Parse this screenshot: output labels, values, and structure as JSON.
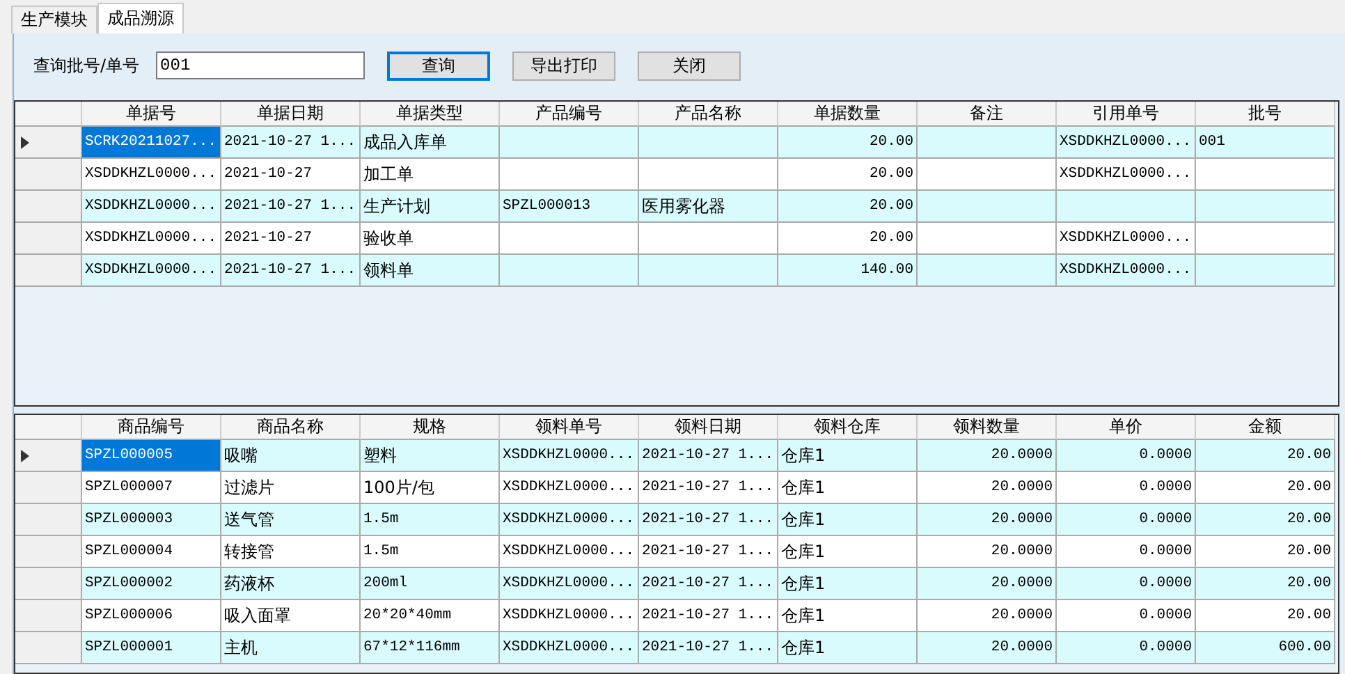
{
  "tabs": [
    {
      "label": "生产模块",
      "selected": false
    },
    {
      "label": "成品溯源",
      "selected": true
    }
  ],
  "query": {
    "label": "查询批号/单号",
    "value": "001"
  },
  "buttons": [
    {
      "label": "查询",
      "default": true
    },
    {
      "label": "导出打印",
      "default": false
    },
    {
      "label": "关闭",
      "default": false
    }
  ],
  "top_grid": {
    "columns": [
      {
        "title": "单据号",
        "kind": "text"
      },
      {
        "title": "单据日期",
        "kind": "text"
      },
      {
        "title": "单据类型",
        "kind": "text"
      },
      {
        "title": "产品编号",
        "kind": "text"
      },
      {
        "title": "产品名称",
        "kind": "text"
      },
      {
        "title": "单据数量",
        "kind": "number"
      },
      {
        "title": "备注",
        "kind": "text"
      },
      {
        "title": "引用单号",
        "kind": "text"
      },
      {
        "title": "批号",
        "kind": "text"
      }
    ],
    "rows": [
      {
        "selected": true,
        "cells": [
          "SCRK20211027...",
          "2021-10-27 1...",
          "成品入库单",
          "",
          "",
          "20.00",
          "",
          "XSDDKHZL0000...",
          "001"
        ]
      },
      {
        "selected": false,
        "cells": [
          "XSDDKHZL0000...",
          "2021-10-27",
          "加工单",
          "",
          "",
          "20.00",
          "",
          "XSDDKHZL0000...",
          ""
        ]
      },
      {
        "selected": false,
        "cells": [
          "XSDDKHZL0000...",
          "2021-10-27 1...",
          "生产计划",
          "SPZL000013",
          "医用雾化器",
          "20.00",
          "",
          "",
          ""
        ]
      },
      {
        "selected": false,
        "cells": [
          "XSDDKHZL0000...",
          "2021-10-27",
          "验收单",
          "",
          "",
          "20.00",
          "",
          "XSDDKHZL0000...",
          ""
        ]
      },
      {
        "selected": false,
        "cells": [
          "XSDDKHZL0000...",
          "2021-10-27 1...",
          "领料单",
          "",
          "",
          "140.00",
          "",
          "XSDDKHZL0000...",
          ""
        ]
      }
    ]
  },
  "bottom_grid": {
    "columns": [
      {
        "title": "商品编号",
        "kind": "text"
      },
      {
        "title": "商品名称",
        "kind": "text"
      },
      {
        "title": "规格",
        "kind": "text"
      },
      {
        "title": "领料单号",
        "kind": "text"
      },
      {
        "title": "领料日期",
        "kind": "text"
      },
      {
        "title": "领料仓库",
        "kind": "text"
      },
      {
        "title": "领料数量",
        "kind": "number"
      },
      {
        "title": "单价",
        "kind": "number"
      },
      {
        "title": "金额",
        "kind": "number"
      }
    ],
    "rows": [
      {
        "selected": true,
        "cells": [
          "SPZL000005",
          "吸嘴",
          "塑料",
          "XSDDKHZL0000...",
          "2021-10-27 1...",
          "仓库1",
          "20.0000",
          "0.0000",
          "20.00"
        ]
      },
      {
        "selected": false,
        "cells": [
          "SPZL000007",
          "过滤片",
          "100片/包",
          "XSDDKHZL0000...",
          "2021-10-27 1...",
          "仓库1",
          "20.0000",
          "0.0000",
          "20.00"
        ]
      },
      {
        "selected": false,
        "cells": [
          "SPZL000003",
          "送气管",
          "1.5m",
          "XSDDKHZL0000...",
          "2021-10-27 1...",
          "仓库1",
          "20.0000",
          "0.0000",
          "20.00"
        ]
      },
      {
        "selected": false,
        "cells": [
          "SPZL000004",
          "转接管",
          "1.5m",
          "XSDDKHZL0000...",
          "2021-10-27 1...",
          "仓库1",
          "20.0000",
          "0.0000",
          "20.00"
        ]
      },
      {
        "selected": false,
        "cells": [
          "SPZL000002",
          "药液杯",
          "200ml",
          "XSDDKHZL0000...",
          "2021-10-27 1...",
          "仓库1",
          "20.0000",
          "0.0000",
          "20.00"
        ]
      },
      {
        "selected": false,
        "cells": [
          "SPZL000006",
          "吸入面罩",
          "20*20*40mm",
          "XSDDKHZL0000...",
          "2021-10-27 1...",
          "仓库1",
          "20.0000",
          "0.0000",
          "20.00"
        ]
      },
      {
        "selected": false,
        "cells": [
          "SPZL000001",
          "主机",
          "67*12*116mm",
          "XSDDKHZL0000...",
          "2021-10-27 1...",
          "仓库1",
          "20.0000",
          "0.0000",
          "600.00"
        ]
      }
    ]
  }
}
